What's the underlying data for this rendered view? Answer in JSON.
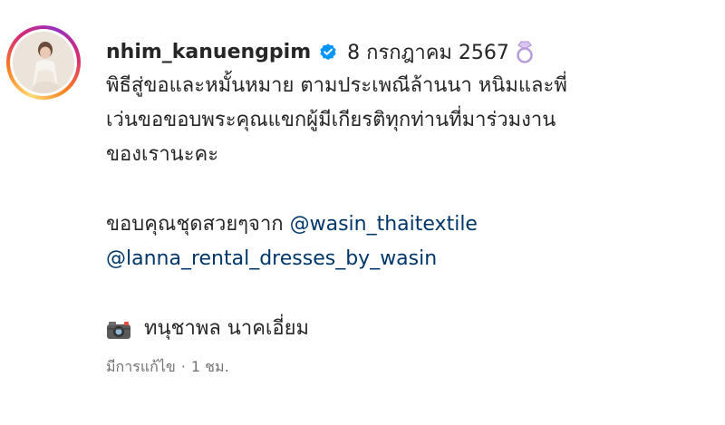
{
  "post": {
    "username": "nhim_kanuengpim",
    "date": "8 กรกฎาคม 2567",
    "caption_lines": [
      "พิธีสู่ขอและหมั้นหมาย ตามประเพณีล้านนา หนิมและพี่",
      "เว่นขอขอบพระคุณแขกผู้มีเกียรติทุกท่านที่มาร่วมงาน",
      "ของเรานะคะ"
    ],
    "thanks_prefix": "ขอบคุณชุดสวยๆจาก",
    "mention_1": "@wasin_thaitextile",
    "mention_2": "@lanna_rental_dresses_by_wasin",
    "photographer": "ทนุชาพล นาคเอี่ยม",
    "edited_label": "มีการแก้ไข",
    "separator": "·",
    "time_ago": "1 ชม."
  },
  "icons": {
    "verified": "verified-badge-icon",
    "ring": "ring-emoji-icon",
    "camera": "camera-emoji-icon"
  },
  "colors": {
    "text": "#262626",
    "mention": "#00376b",
    "muted": "#737373",
    "verified": "#0095f6"
  }
}
